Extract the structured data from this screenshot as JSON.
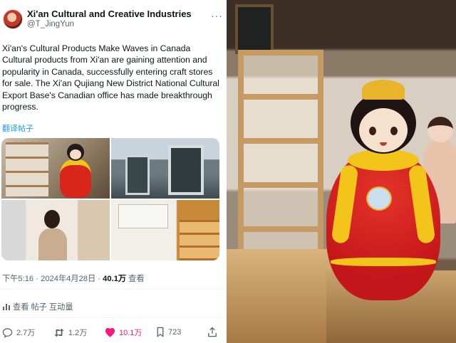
{
  "tweet": {
    "display_name": "Xi'an Cultural and Creative Industries",
    "handle": "@T_JingYun",
    "more_icon": "more-dots-icon",
    "text_lines": [
      "Xi'an's Cultural Products Make Waves in Canada",
      "Cultural products from Xi'an are gaining attention and popularity in Canada, successfully entering craft stores for sale. The Xi'an Qujiang New District National Cultural Export Base's Canadian office has made breakthrough progress."
    ],
    "translate_label": "翻译帖子",
    "photos": [
      {
        "name": "shop-doll-photo"
      },
      {
        "name": "storefront-photo"
      },
      {
        "name": "woman-portrait-photo"
      },
      {
        "name": "office-sign-photo",
        "sign_text": ""
      }
    ],
    "timestamp": "下午5:16 · 2024年4月28日 ·",
    "views_count": "40.1万",
    "views_label": "查看",
    "engagement_label": "查看 帖子 互动量",
    "actions": {
      "replies": "2.7万",
      "retweets": "1.2万",
      "likes": "10.1万",
      "bookmarks": "723"
    }
  },
  "colors": {
    "accent": "#1d9bf0",
    "like": "#f91880",
    "muted": "#536471",
    "text": "#0f1419"
  },
  "side_photo": {
    "subject": "red-yellow-doll-figurine"
  }
}
